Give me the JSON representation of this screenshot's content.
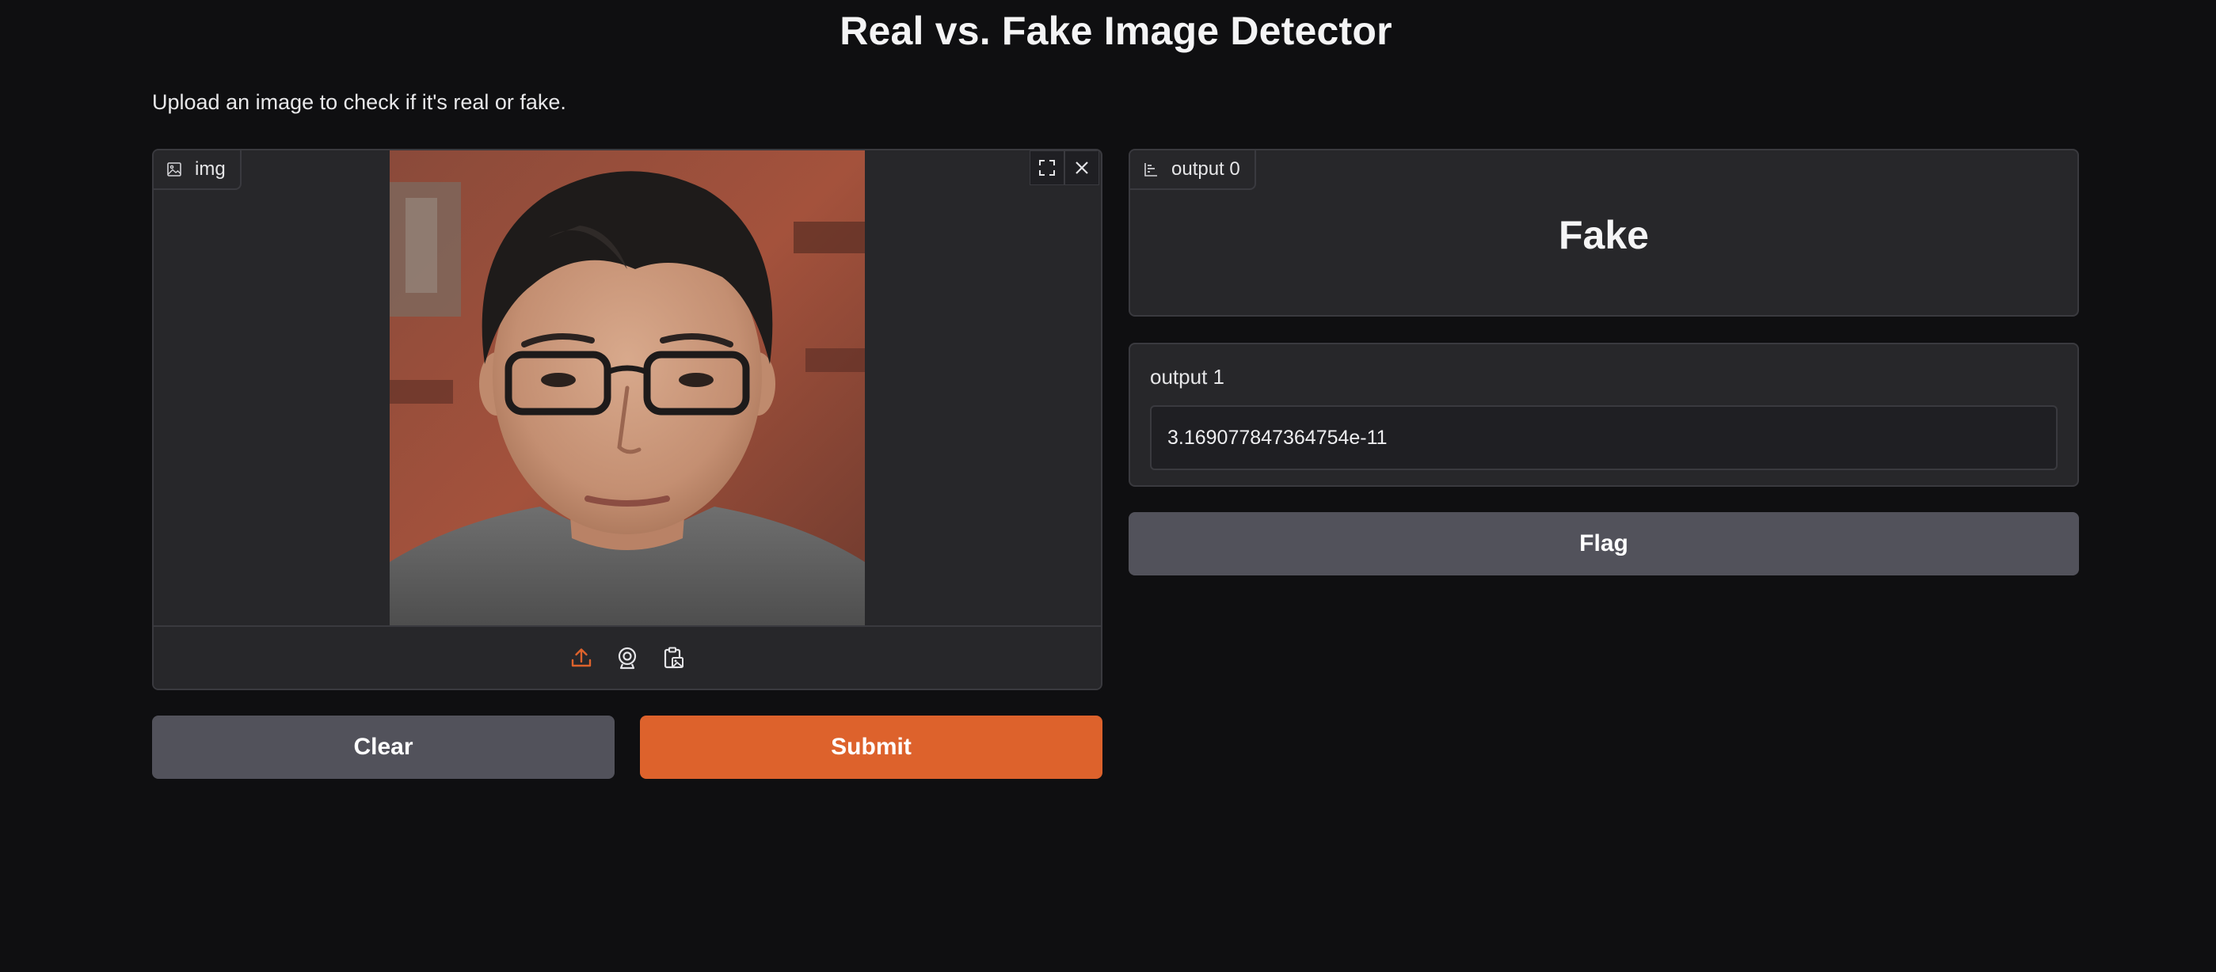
{
  "page": {
    "title": "Real vs. Fake Image Detector",
    "description": "Upload an image to check if it's real or fake."
  },
  "input_image": {
    "label": "img",
    "label_icon": "image-icon",
    "top_actions": [
      "fullscreen-icon",
      "close-icon"
    ],
    "sources": [
      "upload-icon",
      "webcam-icon",
      "clipboard-icon"
    ],
    "active_source_color": "#dd622c"
  },
  "actions": {
    "clear_label": "Clear",
    "submit_label": "Submit",
    "flag_label": "Flag"
  },
  "outputs": {
    "label_output": {
      "label": "output 0",
      "label_icon": "bar-chart-icon",
      "value": "Fake"
    },
    "text_output": {
      "label": "output 1",
      "value": "3.169077847364754e-11"
    }
  },
  "colors": {
    "background": "#0f0f11",
    "panel": "#27272a",
    "border": "#3a3a3f",
    "primary": "#dd622c",
    "secondary": "#52525b"
  }
}
